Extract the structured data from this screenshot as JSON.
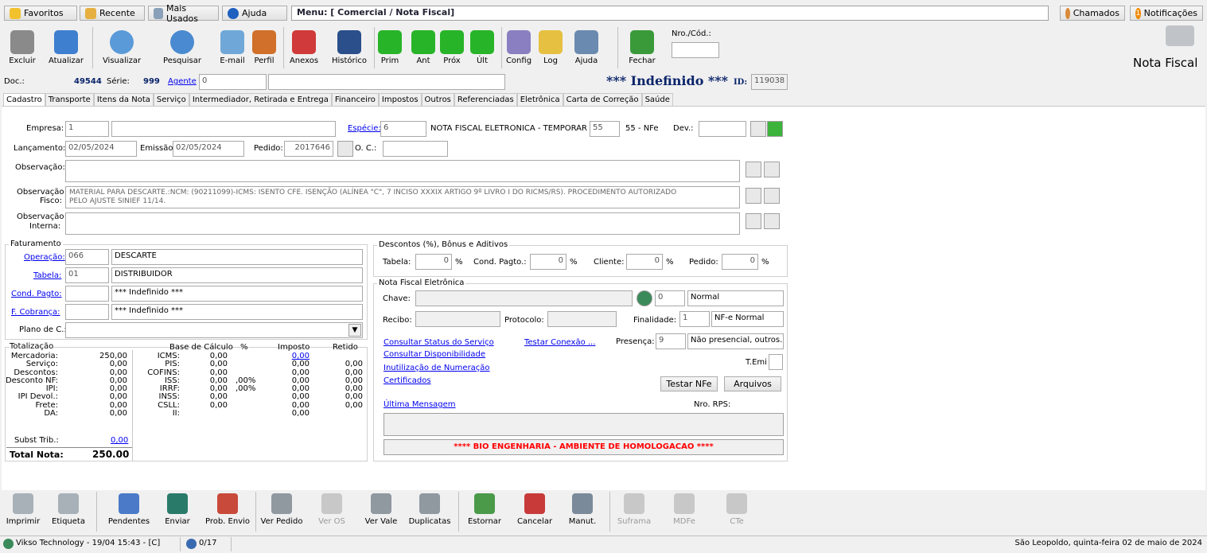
{
  "topbar": {
    "favoritos": "Favoritos",
    "recente": "Recente",
    "mais_usados": "Mais Usados",
    "ajuda": "Ajuda",
    "menu": "Menu: [ Comercial / Nota Fiscal]",
    "chamados": "Chamados",
    "notificacoes": "Notificações",
    "notif_count": "1"
  },
  "toolbar": {
    "excluir": "Excluir",
    "atualizar": "Atualizar",
    "visualizar": "Visualizar",
    "pesquisar": "Pesquisar",
    "email": "E-mail",
    "perfil": "Perfil",
    "anexos": "Anexos",
    "historico": "Histórico",
    "prim": "Prim",
    "ant": "Ant",
    "prox": "Próx",
    "ult": "Últ",
    "config": "Config",
    "log": "Log",
    "ajuda": "Ajuda",
    "fechar": "Fechar",
    "nro_cod": "Nro./Cód.:",
    "nota_fiscal": "Nota Fiscal"
  },
  "doc": {
    "label": "Doc.:",
    "number": "49544",
    "serie_label": "Série:",
    "serie": "999",
    "agente_label": "Agente",
    "agente": "0",
    "status": "*** Indefinido ***",
    "id_label": "ID:",
    "id": "119038"
  },
  "tabs": [
    "Cadastro",
    "Transporte",
    "Itens da Nota",
    "Serviço",
    "Intermediador, Retirada e Entrega",
    "Financeiro",
    "Impostos",
    "Outros",
    "Referenciadas",
    "Eletrônica",
    "Carta de Correção",
    "Saúde"
  ],
  "cad": {
    "empresa_label": "Empresa:",
    "empresa": "1",
    "especie_label": "Espécie:",
    "especie": "6",
    "especie_desc": "NOTA FISCAL ELETRÔNICA - TEMPORÁR",
    "modelo": "55",
    "modelo_desc": "55 - NFe",
    "dev_label": "Dev.:",
    "lancamento_label": "Lançamento:",
    "lancamento": "02/05/2024",
    "emissao_label": "Emissão",
    "emissao": "02/05/2024",
    "pedido_label": "Pedido:",
    "pedido": "2017646",
    "oc_label": "O. C.:",
    "obs_label": "Observação:",
    "obs_fisco_label1": "Observação",
    "obs_fisco_label2": "Fisco:",
    "obs_fisco_1": "MATERIAL PARA DESCARTE.:NCM: (90211099)-ICMS: ISENTO CFE. ISENÇÃO (ALÍNEA \"C\", 7 INCISO XXXIX ARTIGO 9º LIVRO I DO RICMS/RS). PROCEDIMENTO AUTORIZADO",
    "obs_fisco_2": "PELO AJUSTE SINIEF 11/14.",
    "obs_int_label1": "Observação",
    "obs_int_label2": "Interna:"
  },
  "fat": {
    "title": "Faturamento",
    "operacao_label": "Operação:",
    "operacao": "066",
    "operacao_desc": "DESCARTE",
    "tabela_label": "Tabela:",
    "tabela": "01",
    "tabela_desc": "DISTRIBUIDOR",
    "cond_label": "Cond. Pagto:",
    "cond_desc": "*** Indefinido ***",
    "cobranca_label": "F. Cobrança:",
    "cobranca_desc": "*** Indefinido ***",
    "plano_label": "Plano de C.:"
  },
  "desc": {
    "title": "Descontos (%), Bônus e Aditivos",
    "tabela_label": "Tabela:",
    "tabela": "0",
    "cond_label": "Cond. Pagto.:",
    "cond": "0",
    "cliente_label": "Cliente:",
    "cliente": "0",
    "pedido_label": "Pedido:",
    "pedido": "0",
    "pct": "%"
  },
  "tot": {
    "title": "Totalização",
    "col_base": "Base de Cálculo",
    "col_pct": "%",
    "col_imposto": "Imposto",
    "col_retido": "Retido",
    "left_labels": "Mercadoria:\n   Serviço:\n Descontos:\nDesconto NF:\n      IPI:\nIPI Devol.:\n     Frete:\n        DA:",
    "left_values": "250,00\n  0,00\n  0,00\n  0,00\n  0,00\n  0,00\n  0,00\n  0,00",
    "tax_labels": "  ICMS:\n   PIS:\nCOFINS:\n   ISS:\n  IRRF:\n  INSS:\n  CSLL:\n    II:",
    "tax_base": "0,00\n0,00\n0,00\n0,00\n0,00\n0,00\n0,00",
    "tax_pct": "\n\n\n,00%\n,00%",
    "tax_imposto": "\n0,00\n0,00\n0,00\n0,00\n0,00\n0,00\n0,00",
    "icms_imposto": "0,00",
    "tax_retido": "\n0,00\n0,00\n0,00\n0,00\n0,00\n0,00",
    "subst_label": "Subst Trib.:",
    "subst_value": "0,00",
    "total_label": "Total Nota:",
    "total_value": "250.00"
  },
  "nfe": {
    "title": "Nota Fiscal Eletrônica",
    "chave_label": "Chave:",
    "chave_num": "0",
    "chave_desc": "Normal",
    "recibo_label": "Recibo:",
    "protocolo_label": "Protocolo:",
    "finalidade_label": "Finalidade:",
    "finalidade": "1",
    "finalidade_desc": "NF-e Normal",
    "consultar_status": "Consultar Status do Serviço",
    "testar_conexao": "Testar Conexão ...",
    "presenca_label": "Presença:",
    "presenca": "9",
    "presenca_desc": "Não presencial, outros.",
    "consultar_disp": "Consultar Disponibilidade",
    "inutilizacao": "Inutilização de Numeração",
    "temi_label": "T.Emi",
    "certificados": "Certificados",
    "testar_nfe": "Testar NFe",
    "arquivos": "Arquivos",
    "ultima_msg": "Última Mensagem",
    "nro_rps": "Nro. RPS:",
    "ambiente": "**** BIO ENGENHARIA - AMBIENTE DE HOMOLOGACAO ****"
  },
  "bottombar": [
    "Imprimir",
    "Etiqueta",
    "Pendentes",
    "Enviar",
    "Prob. Envio",
    "Ver Pedido",
    "Ver OS",
    "Ver Vale",
    "Duplicatas",
    "Estornar",
    "Cancelar",
    "Manut.",
    "Suframa",
    "MDFe",
    "CTe"
  ],
  "status": {
    "company": "Vikso Technology - 19/04 15:43 - [C]",
    "users": "0/17",
    "date": "São Leopoldo, quinta-feira 02 de maio de 2024"
  },
  "colors": {
    "accent": "#0a246a",
    "link": "#0000ee",
    "alert": "#ff0000"
  }
}
